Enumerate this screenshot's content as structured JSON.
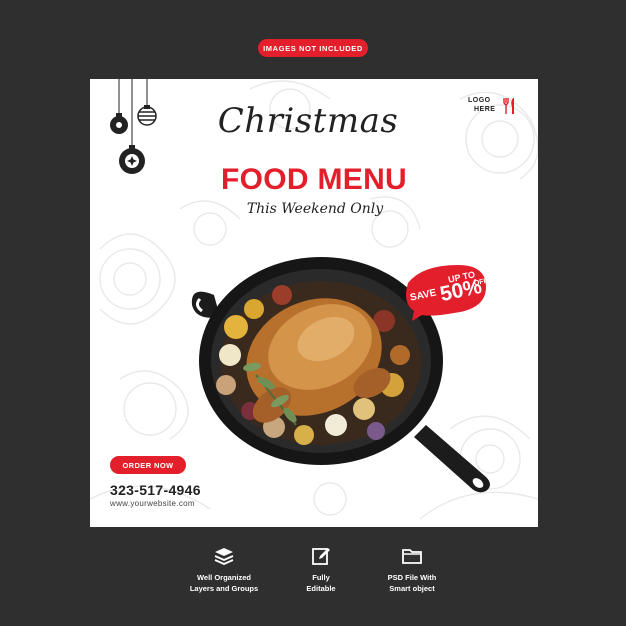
{
  "top_badge": "IMAGES NOT INCLUDED",
  "card": {
    "logo_line1": "LOGO",
    "logo_line2": "HERE",
    "script_title": "Christmas",
    "main_title": "FOOD MENU",
    "tagline": "This Weekend Only",
    "promo": {
      "upto": "UP TO",
      "save": "SAVE",
      "percent": "50%",
      "off": "OFF"
    },
    "order_button": "ORDER NOW",
    "phone": "323-517-4946",
    "website": "www.yourwebsite.com"
  },
  "features": [
    {
      "icon": "layers-icon",
      "line1": "Well Organized",
      "line2": "Layers and Groups"
    },
    {
      "icon": "edit-icon",
      "line1": "Fully",
      "line2": "Editable"
    },
    {
      "icon": "folder-icon",
      "line1": "PSD File With",
      "line2": "Smart object"
    }
  ],
  "colors": {
    "background": "#2f2f2f",
    "accent": "#e31f2b",
    "card": "#ffffff",
    "text": "#222222"
  }
}
